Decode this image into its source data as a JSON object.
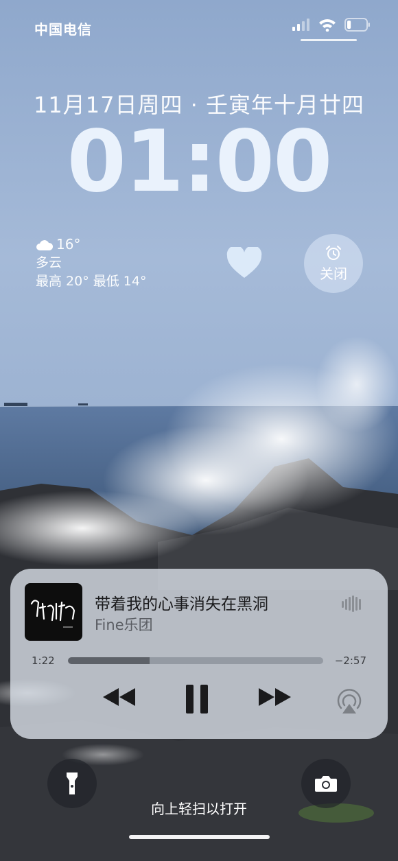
{
  "status_bar": {
    "carrier": "中国电信",
    "signal_icon": "cellular-signal-icon",
    "wifi_icon": "wifi-icon",
    "battery_icon": "battery-icon",
    "battery_level": 0.2
  },
  "lock_screen": {
    "date_line": "11月17日周四 · 壬寅年十月廿四",
    "time": "01:00"
  },
  "weather": {
    "icon": "cloud-icon",
    "temperature": "16°",
    "condition": "多云",
    "range": "最高 20° 最低 14°"
  },
  "widgets": {
    "heart_icon": "heart-icon",
    "alarm_icon": "alarm-clock-icon",
    "alarm_label": "关闭"
  },
  "now_playing": {
    "title": "带着我的心事消失在黑洞",
    "artist": "Fine乐团",
    "elapsed": "1:22",
    "remaining": "−2:57",
    "progress": 0.32,
    "controls": [
      "rewind-icon",
      "pause-icon",
      "fast-forward-icon",
      "airplay-icon"
    ]
  },
  "bottom": {
    "flashlight_icon": "flashlight-icon",
    "camera_icon": "camera-icon",
    "swipe_hint": "向上轻扫以打开"
  },
  "colors": {
    "sky": "#a5bad8",
    "sea": "#3c5878",
    "rock": "#2e3035",
    "card": "#d6dce4"
  }
}
